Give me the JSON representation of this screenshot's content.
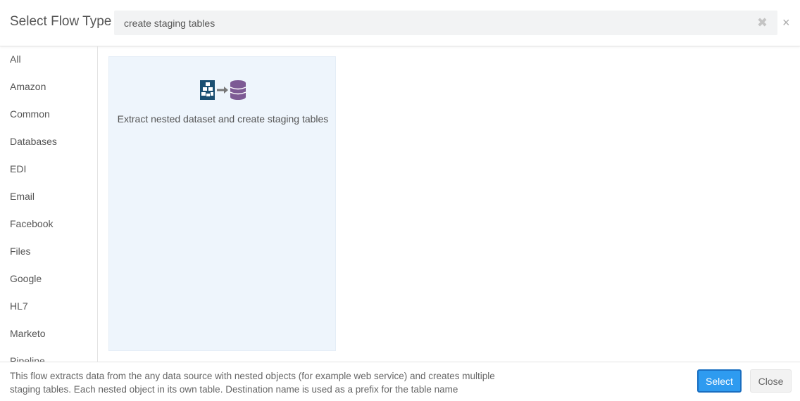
{
  "dialog": {
    "title": "Select Flow Type",
    "close_icon": "close-icon"
  },
  "search": {
    "value": "create staging tables",
    "clear_icon": "clear-icon"
  },
  "sidebar": {
    "items": [
      {
        "label": "All"
      },
      {
        "label": "Amazon"
      },
      {
        "label": "Common"
      },
      {
        "label": "Databases"
      },
      {
        "label": "EDI"
      },
      {
        "label": "Email"
      },
      {
        "label": "Facebook"
      },
      {
        "label": "Files"
      },
      {
        "label": "Google"
      },
      {
        "label": "HL7"
      },
      {
        "label": "Marketo"
      },
      {
        "label": "Pipeline"
      }
    ]
  },
  "results": [
    {
      "label": "Extract nested dataset and create staging tables",
      "icon": "nested-to-database-icon",
      "selected": true
    }
  ],
  "footer": {
    "description_line1": "This flow extracts data from the any data source with nested objects (for example web service) and creates multiple",
    "description_line2": "staging tables. Each nested object in its own table. Destination name is used as a prefix for the table name",
    "select_label": "Select",
    "close_label": "Close"
  },
  "colors": {
    "accent": "#2e9bf0",
    "selected_card_bg": "#eef5fc",
    "icon_blue": "#1b4f72",
    "icon_purple": "#7d5a94"
  }
}
